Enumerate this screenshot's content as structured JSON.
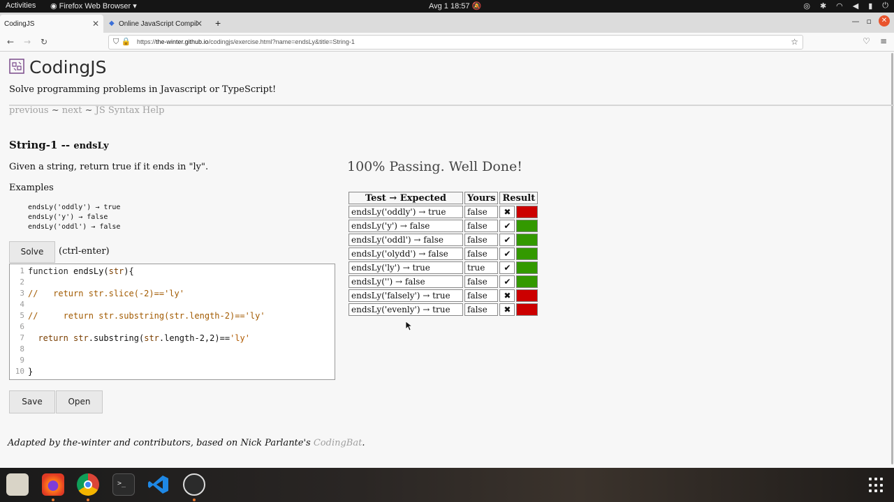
{
  "topbar": {
    "activities": "Activities",
    "app_menu": "Firefox Web Browser",
    "clock": "Avg 1  18:57"
  },
  "tabs": [
    {
      "label": "CodingJS"
    },
    {
      "label": "Online JavaScript Compil"
    }
  ],
  "navbar": {
    "url_prefix": "https://",
    "url_host": "the-winter.github.io",
    "url_path": "/codingjs/exercise.html?name=endsLy&title=String-1"
  },
  "site": {
    "title": "CodingJS",
    "tagline": "Solve programming problems in Javascript or TypeScript!",
    "nav_previous": "previous",
    "nav_sep": "~",
    "nav_next": "next",
    "nav_syntax": "JS Syntax Help"
  },
  "problem": {
    "title_prefix": "String-1 -- ",
    "function_name": "endsLy",
    "description": "Given a string, return true if it ends in \"ly\".",
    "examples_label": "Examples",
    "examples": [
      "endsLy('oddly') → true",
      "endsLy('y') → false",
      "endsLy('oddl') → false"
    ]
  },
  "controls": {
    "solve_label": "Solve",
    "solve_hint": "(ctrl-enter)",
    "save_label": "Save",
    "open_label": "Open"
  },
  "editor": {
    "line_numbers": [
      "1",
      "2",
      "3",
      "4",
      "5",
      "6",
      "7",
      "8",
      "9",
      "10"
    ]
  },
  "results": {
    "summary": "100% Passing. Well Done!",
    "headers": {
      "test": "Test → Expected",
      "yours": "Yours",
      "result": "Result"
    },
    "rows": [
      {
        "test": "endsLy('oddly') → true",
        "yours": "false",
        "mark": "✖",
        "color": "#cc0000"
      },
      {
        "test": "endsLy('y') → false",
        "yours": "false",
        "mark": "✔",
        "color": "#339900"
      },
      {
        "test": "endsLy('oddl') → false",
        "yours": "false",
        "mark": "✔",
        "color": "#339900"
      },
      {
        "test": "endsLy('olydd') → false",
        "yours": "false",
        "mark": "✔",
        "color": "#339900"
      },
      {
        "test": "endsLy('ly') → true",
        "yours": "true",
        "mark": "✔",
        "color": "#339900"
      },
      {
        "test": "endsLy('') → false",
        "yours": "false",
        "mark": "✔",
        "color": "#339900"
      },
      {
        "test": "endsLy('falsely') → true",
        "yours": "false",
        "mark": "✖",
        "color": "#cc0000"
      },
      {
        "test": "endsLy('evenly') → true",
        "yours": "false",
        "mark": "✖",
        "color": "#cc0000"
      }
    ]
  },
  "footer": {
    "text": "Adapted by the-winter and contributors, based on Nick Parlante's ",
    "link": "CodingBat",
    "end": "."
  },
  "colors": {
    "pass": "#339900",
    "fail": "#cc0000",
    "link": "#a0a0a0"
  }
}
